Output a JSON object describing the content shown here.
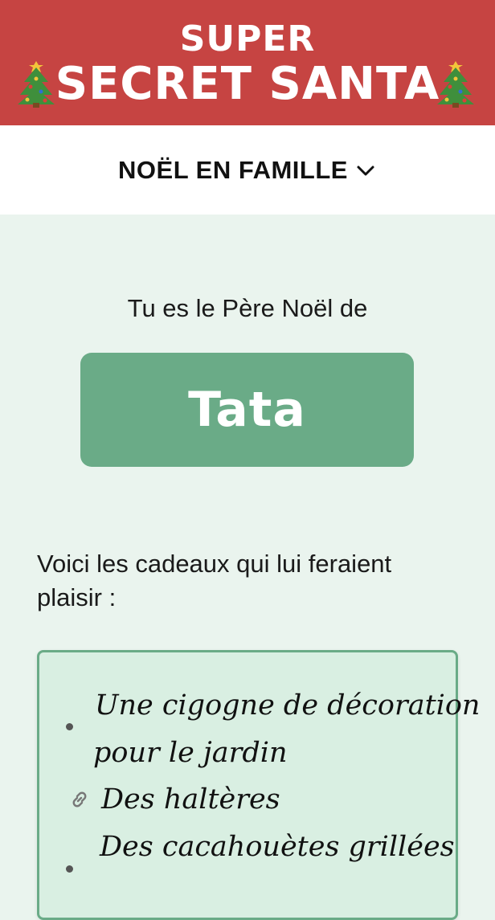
{
  "header": {
    "title_line1": "SUPER",
    "title_line2": "SECRET SANTA",
    "icon_left": "christmas-tree-icon",
    "icon_right": "christmas-tree-icon",
    "background_color": "#c64442"
  },
  "group_selector": {
    "label": "NOËL EN FAMILLE",
    "icon": "chevron-down-icon"
  },
  "assignment": {
    "intro": "Tu es le Père Noël de",
    "recipient": "Tata",
    "card_color": "#6aab87"
  },
  "wishlist": {
    "intro": "Voici les cadeaux qui lui feraient plaisir :",
    "items": [
      {
        "line1": "Une cigogne de décoration",
        "line2": "pour le jardin",
        "marker": "bullet"
      },
      {
        "line1": "Des haltères",
        "marker": "link-icon"
      },
      {
        "line1": "Des cacahouètes grillées",
        "marker": "bullet"
      }
    ]
  }
}
